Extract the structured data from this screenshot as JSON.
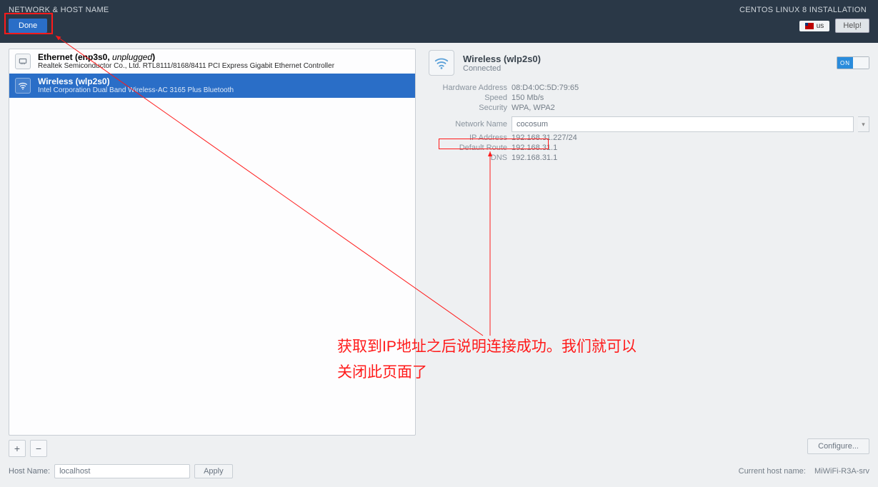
{
  "header": {
    "title": "NETWORK & HOST NAME",
    "done_label": "Done",
    "install_title": "CENTOS LINUX 8 INSTALLATION",
    "keyboard": "us",
    "help_label": "Help!"
  },
  "net_list": {
    "items": [
      {
        "title_prefix": "Ethernet (enp3s0, ",
        "title_italic": "unplugged",
        "title_suffix": ")",
        "subtitle": "Realtek Semiconductor Co., Ltd. RTL8111/8168/8411 PCI Express Gigabit Ethernet Controller"
      },
      {
        "title": "Wireless (wlp2s0)",
        "subtitle": "Intel Corporation Dual Band Wireless-AC 3165 Plus Bluetooth"
      }
    ],
    "add_label": "+",
    "remove_label": "−"
  },
  "detail": {
    "title": "Wireless (wlp2s0)",
    "status": "Connected",
    "toggle_on": "ON",
    "rows": {
      "hw_key": "Hardware Address",
      "hw_val": "08:D4:0C:5D:79:65",
      "speed_key": "Speed",
      "speed_val": "150 Mb/s",
      "sec_key": "Security",
      "sec_val": "WPA, WPA2",
      "net_key": "Network Name",
      "net_val": "cocosum",
      "ip_key": "IP Address",
      "ip_val": "192.168.31.227/24",
      "route_key": "Default Route",
      "route_val": "192.168.31.1",
      "dns_key": "DNS",
      "dns_val": "192.168.31.1"
    },
    "configure_label": "Configure...",
    "hostname_label": "Host Name:",
    "hostname_value": "localhost",
    "apply_label": "Apply",
    "current_host_label": "Current host name:",
    "current_host_value": "MiWiFi-R3A-srv"
  },
  "annotation": {
    "line1": "获取到IP地址之后说明连接成功。我们就可以",
    "line2": "关闭此页面了"
  }
}
